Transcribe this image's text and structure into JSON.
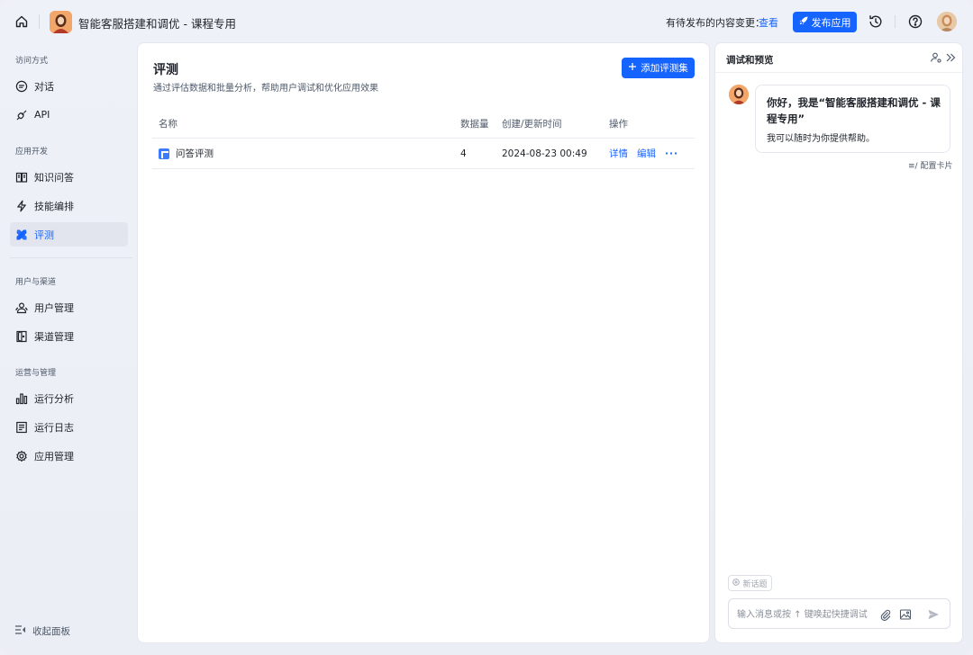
{
  "header": {
    "app_title": "智能客服搭建和调优 - 课程专用",
    "pending_text": "有待发布的内容变更：",
    "pending_link": "查看",
    "publish_label": "发布应用"
  },
  "sidebar": {
    "sections": [
      {
        "title": "访问方式"
      },
      {
        "title": "应用开发"
      },
      {
        "title": "用户与渠道"
      },
      {
        "title": "运营与管理"
      }
    ],
    "items": [
      {
        "label": "对话",
        "icon": "chat-icon"
      },
      {
        "label": "API",
        "icon": "api-icon"
      },
      {
        "label": "知识问答",
        "icon": "book-icon"
      },
      {
        "label": "技能编排",
        "icon": "lightning-icon"
      },
      {
        "label": "评测",
        "icon": "evaluation-icon",
        "active": true
      },
      {
        "label": "用户管理",
        "icon": "users-icon"
      },
      {
        "label": "渠道管理",
        "icon": "channel-icon"
      },
      {
        "label": "运行分析",
        "icon": "bar-chart-icon"
      },
      {
        "label": "运行日志",
        "icon": "log-icon"
      },
      {
        "label": "应用管理",
        "icon": "gear-icon"
      }
    ],
    "collapse_label": "收起面板"
  },
  "main": {
    "title": "评测",
    "description": "通过评估数据和批量分析，帮助用户调试和优化应用效果",
    "add_button": "添加评测集",
    "columns": [
      "名称",
      "数据量",
      "创建/更新时间",
      "操作"
    ],
    "rows": [
      {
        "name": "问答评测",
        "count": "4",
        "time": "2024-08-23 00:49",
        "actions": [
          "详情",
          "编辑"
        ],
        "more": "···"
      }
    ]
  },
  "preview": {
    "title": "调试和预览",
    "greeting_title": "你好，我是“智能客服搭建和调优 - 课程专用”",
    "greeting_sub": "我可以随时为你提供帮助。",
    "config_card": "配置卡片",
    "new_topic": "新话题",
    "input_placeholder": "输入消息或按 ↑ 键唤起快捷调试"
  },
  "colors": {
    "accent": "#1664ff",
    "sidebar_active_bg": "#e2e5ee"
  }
}
